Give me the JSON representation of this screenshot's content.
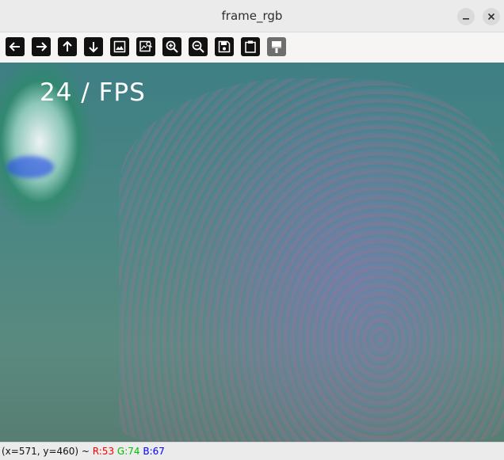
{
  "window": {
    "title": "frame_rgb",
    "controls": {
      "minimize": "minimize-icon",
      "close": "close-icon"
    }
  },
  "toolbar": {
    "buttons": [
      {
        "name": "pan-left",
        "icon": "arrow-left-icon"
      },
      {
        "name": "pan-right",
        "icon": "arrow-right-icon"
      },
      {
        "name": "pan-up",
        "icon": "arrow-up-icon"
      },
      {
        "name": "pan-down",
        "icon": "arrow-down-icon"
      },
      {
        "name": "zoom-fit",
        "icon": "image-icon"
      },
      {
        "name": "zoom-original",
        "icon": "image-magnify-icon"
      },
      {
        "name": "zoom-in",
        "icon": "zoom-in-icon"
      },
      {
        "name": "zoom-out",
        "icon": "zoom-out-icon"
      },
      {
        "name": "save",
        "icon": "save-icon"
      },
      {
        "name": "copy",
        "icon": "clipboard-icon"
      },
      {
        "name": "properties",
        "icon": "paint-brush-icon",
        "disabled": true
      }
    ]
  },
  "viewport": {
    "overlay_text": "24 / FPS"
  },
  "status": {
    "coords": "(x=571, y=460) ~ ",
    "r": "R:53",
    "g": "G:74",
    "b": "B:67"
  }
}
